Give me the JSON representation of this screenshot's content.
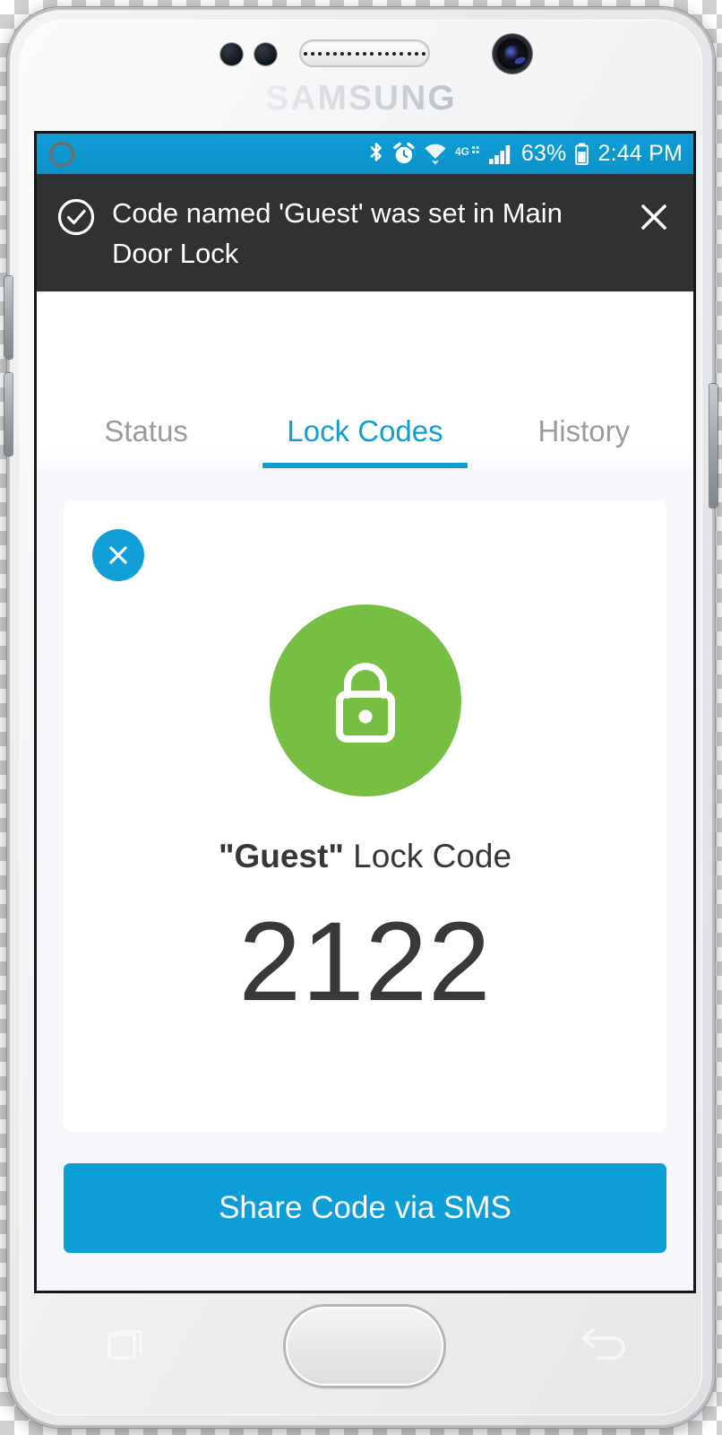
{
  "device": {
    "brand": "SAMSUNG",
    "hardware": {
      "earpiece": "earpiece-speaker",
      "front_camera": "front-camera",
      "proximity_sensor": "proximity-sensor",
      "light_sensor": "light-sensor",
      "volume_up": "volume-up-button",
      "volume_down": "volume-down-button",
      "power": "power-button",
      "home": "home-button",
      "recents": "recents-button",
      "back": "back-button"
    }
  },
  "statusbar": {
    "left_icon": "circle-outline-icon",
    "icons": [
      "bluetooth-icon",
      "alarm-icon",
      "wifi-icon",
      "4g-icon",
      "signal-bars-icon"
    ],
    "network_label": "4G",
    "battery_percent": "63%",
    "battery_icon": "battery-icon",
    "time": "2:44 PM"
  },
  "toast": {
    "icon": "check-circle-icon",
    "message": "Code named 'Guest' was set in Main Door Lock",
    "close_icon": "close-icon"
  },
  "tabs": [
    {
      "label": "Status",
      "active": false
    },
    {
      "label": "Lock Codes",
      "active": true
    },
    {
      "label": "History",
      "active": false
    }
  ],
  "card": {
    "close_icon": "close-icon",
    "status_icon": "lock-closed-icon",
    "code_name": "\"Guest\"",
    "code_label_suffix": " Lock Code",
    "code_value": "2122"
  },
  "actions": {
    "share_label": "Share Code via SMS"
  },
  "colors": {
    "accent_blue": "#0e9ed6",
    "button_blue": "#0d9ed8",
    "status_green": "#76bf43",
    "toast_bg": "#2f3133",
    "screen_bg": "#f5f7fb",
    "card_bg": "#ffffff",
    "tab_inactive": "#9b9b9b",
    "text_dark": "#37393b"
  }
}
